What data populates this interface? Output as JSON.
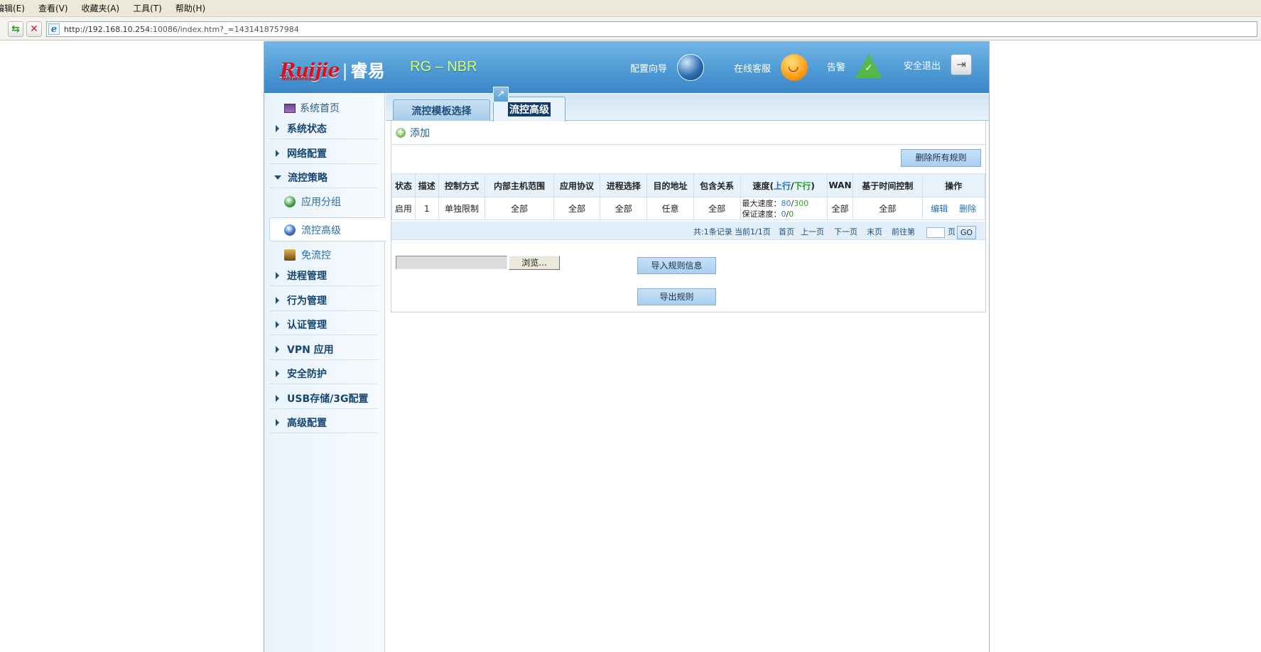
{
  "browser": {
    "menu": [
      "编辑(E)",
      "查看(V)",
      "收藏夹(A)",
      "工具(T)",
      "帮助(H)"
    ],
    "url_host": "http://192.168.10.254:",
    "url_rest": "10086/index.htm?_=1431418757984"
  },
  "header": {
    "logo_ruijie": "Ruijie",
    "logo_cn": "睿易",
    "logo_sub": "Networks",
    "model": "RG – NBR",
    "wizard_label": "配置向导",
    "service_label": "在线客服",
    "alarm_label": "告警",
    "logout_label": "安全退出"
  },
  "sidebar": {
    "home": "系统首页",
    "categories": {
      "system_status": "系统状态",
      "network_config": "网络配置",
      "flow_policy": "流控策略",
      "process_mgmt": "进程管理",
      "behavior_mgmt": "行为管理",
      "auth_mgmt": "认证管理",
      "vpn": "VPN 应用",
      "security": "安全防护",
      "usb": "USB存储/3G配置",
      "advanced": "高级配置"
    },
    "sub_items": {
      "app_group": "应用分组",
      "flow_advanced": "流控高级",
      "no_flow": "免流控"
    }
  },
  "main": {
    "tabs": {
      "template": "流控模板选择",
      "advanced": "流控高级"
    },
    "add_label": "添加",
    "delete_all_label": "删除所有规则",
    "table": {
      "headers": {
        "status": "状态",
        "desc": "描述",
        "control": "控制方式",
        "hosts": "内部主机范围",
        "protocol": "应用协议",
        "process": "进程选择",
        "dest": "目的地址",
        "include": "包含关系",
        "speed_prefix": "速度(",
        "speed_up": "上行",
        "speed_slash": "/",
        "speed_down": "下行",
        "speed_suffix": ")",
        "wan": "WAN",
        "time": "基于时间控制",
        "ops": "操作"
      },
      "rows": [
        {
          "status": "启用",
          "desc": "1",
          "control": "单独限制",
          "hosts": "全部",
          "protocol": "全部",
          "process": "全部",
          "dest": "任意",
          "include": "全部",
          "max_label": "最大速度：",
          "max_up": "80",
          "max_down": "300",
          "guar_label": "保证速度：",
          "guar_up": "0",
          "guar_down": "0",
          "wan": "全部",
          "time": "全部",
          "edit": "编辑",
          "delete": "删除"
        }
      ]
    },
    "pager": {
      "total": "共:1条记录",
      "current": "当前1/1页",
      "first": "首页",
      "prev": "上一页",
      "next": "下一页",
      "last": "末页",
      "goto_prefix": "前往第",
      "goto_suffix": "页",
      "go": "GO"
    },
    "browse_label": "浏览...",
    "import_label": "导入规则信息",
    "export_label": "导出规则"
  }
}
